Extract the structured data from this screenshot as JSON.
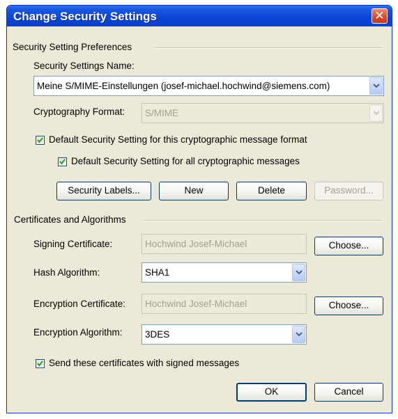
{
  "window": {
    "title": "Change Security Settings",
    "close_glyph": "✕"
  },
  "preferences": {
    "section_label": "Security Setting Preferences",
    "name_label": "Security Settings Name:",
    "name_value": "Meine S/MIME-Einstellungen (josef-michael.hochwind@siemens.com)",
    "format_label": "Cryptography Format:",
    "format_value": "S/MIME",
    "default_format_label": "Default Security Setting for this cryptographic message format",
    "default_format_checked": true,
    "default_all_label": "Default Security Setting for all cryptographic messages",
    "default_all_checked": true,
    "buttons": {
      "labels": "Security Labels...",
      "new": "New",
      "delete": "Delete",
      "password": "Password..."
    }
  },
  "certificates": {
    "section_label": "Certificates and Algorithms",
    "signing_label": "Signing Certificate:",
    "signing_value": "Hochwind Josef-Michael",
    "signing_choose": "Choose...",
    "hash_label": "Hash Algorithm:",
    "hash_value": "SHA1",
    "encryption_label": "Encryption Certificate:",
    "encryption_value": "Hochwind Josef-Michael",
    "encryption_choose": "Choose...",
    "enc_algo_label": "Encryption Algorithm:",
    "enc_algo_value": "3DES",
    "send_certs_label": "Send these certificates with signed messages",
    "send_certs_checked": true
  },
  "footer": {
    "ok": "OK",
    "cancel": "Cancel"
  },
  "icons": {
    "close": "close-icon",
    "dropdown": "chevron-down-icon",
    "check": "checkmark-icon"
  },
  "colors": {
    "titlebar": "#0a45d6",
    "dialog_bg": "#ece9d8",
    "checkmark": "#21a121",
    "close_button": "#d24b27"
  }
}
